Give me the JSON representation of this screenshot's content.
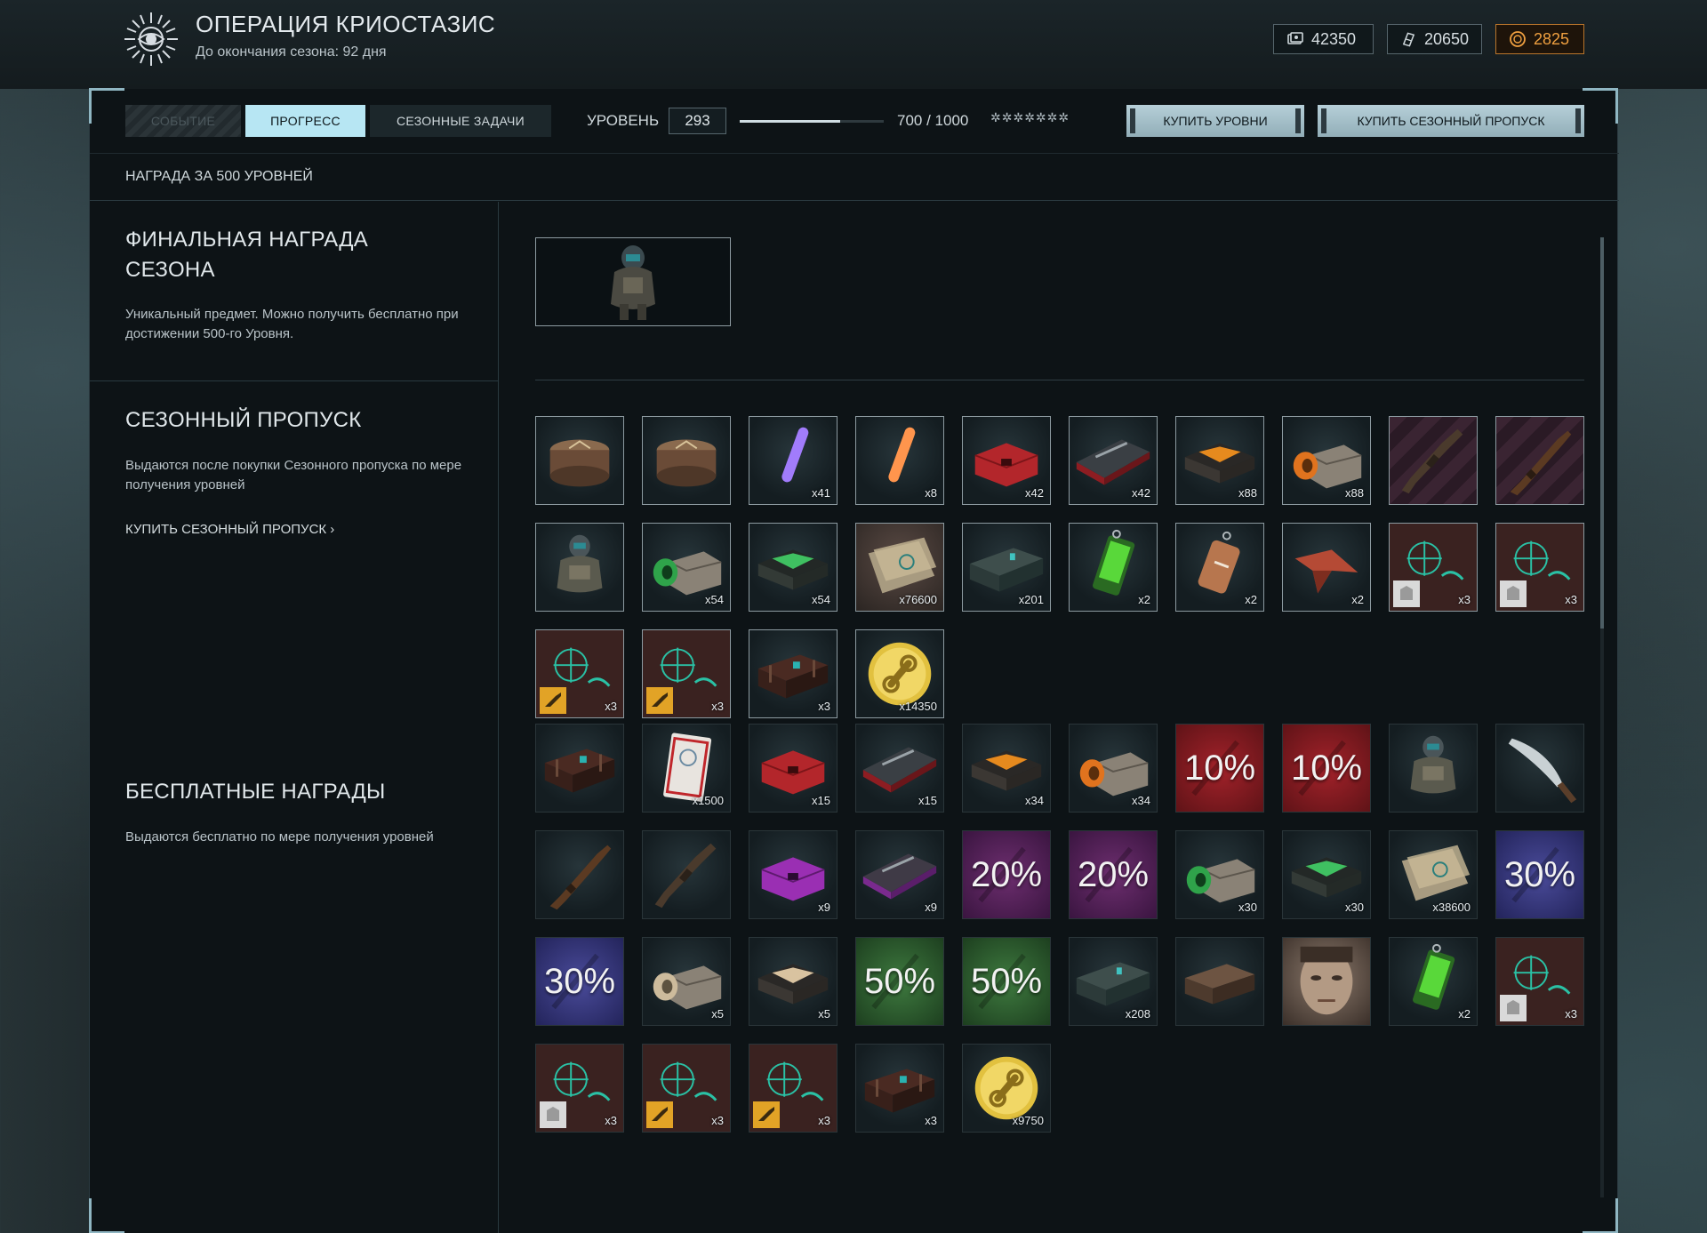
{
  "header": {
    "title": "ОПЕРАЦИЯ КРИОСТАЗИС",
    "subtitle": "До окончания сезона: 92 дня",
    "currencies": [
      {
        "icon": "crowns-icon",
        "value": "42350"
      },
      {
        "icon": "warbucks-icon",
        "value": "20650"
      },
      {
        "icon": "gold-coin-icon",
        "value": "2825",
        "color": "#f0a040"
      }
    ]
  },
  "controls": {
    "tabs": [
      "СОБЫТИЕ",
      "ПРОГРЕСС",
      "СЕЗОННЫЕ ЗАДАЧИ"
    ],
    "active_tab": "ПРОГРЕСС",
    "level_label": "УРОВЕНЬ",
    "level": "293",
    "xp_text": "700 / 1000",
    "xp_fraction": 0.7,
    "stars": "✲✲✲✲✲✲✲",
    "buy_levels": "КУПИТЬ УРОВНИ",
    "buy_pass": "КУПИТЬ СЕЗОННЫЙ ПРОПУСК"
  },
  "subheader": "НАГРАДА ЗА 500 УРОВНЕЙ",
  "sections": {
    "final": {
      "title_line1": "ФИНАЛЬНАЯ НАГРАДА",
      "title_line2": "СЕЗОНА",
      "desc": "Уникальный предмет. Можно получить бесплатно при достижении 500-го Уровня."
    },
    "pass": {
      "title": "СЕЗОННЫЙ ПРОПУСК",
      "desc": "Выдаются после покупки Сезонного пропуска по мере получения уровней",
      "link": "КУПИТЬ СЕЗОННЫЙ ПРОПУСК ›"
    },
    "free": {
      "title": "БЕСПЛАТНЫЕ НАГРАДЫ",
      "desc": "Выдаются бесплатно по мере получения уровней"
    }
  },
  "accent_color": "#b7e6f3",
  "premium_rewards": [
    {
      "icon": "crate-round-icon",
      "count": ""
    },
    {
      "icon": "crate-round-icon",
      "count": ""
    },
    {
      "icon": "purple-glowstick-icon",
      "count": "x41"
    },
    {
      "icon": "orange-glowstick-icon",
      "count": "x8"
    },
    {
      "icon": "red-case-icon",
      "count": "x42"
    },
    {
      "icon": "red-weapon-case-icon",
      "count": "x42"
    },
    {
      "icon": "orange-x-box-icon",
      "count": "x88"
    },
    {
      "icon": "orange-open-box-icon",
      "count": "x88"
    },
    {
      "icon": "rifle-icon",
      "count": ""
    },
    {
      "icon": "shotgun-icon",
      "count": ""
    },
    {
      "icon": "armor-suit-icon",
      "count": ""
    },
    {
      "icon": "green-open-box-icon",
      "count": "x54"
    },
    {
      "icon": "green-x-box-icon",
      "count": "x54"
    },
    {
      "icon": "map-sheets-icon",
      "count": "x76600"
    },
    {
      "icon": "ammo-crate-icon",
      "count": "x201"
    },
    {
      "icon": "green-tag-icon",
      "count": "x2"
    },
    {
      "icon": "dog-tag-icon",
      "count": "x2"
    },
    {
      "icon": "origami-bird-icon",
      "count": "x2"
    },
    {
      "icon": "camo-pattern-icon",
      "count": "x3",
      "tag": "armor"
    },
    {
      "icon": "camo-pattern-icon",
      "count": "x3",
      "tag": "armor"
    },
    {
      "icon": "camo-pattern-icon",
      "count": "x3",
      "tag": "weapon"
    },
    {
      "icon": "camo-pattern-icon",
      "count": "x3",
      "tag": "weapon"
    },
    {
      "icon": "dark-chest-icon",
      "count": "x3"
    },
    {
      "icon": "gold-link-coin-icon",
      "count": "x14350"
    }
  ],
  "free_rewards": [
    {
      "icon": "dark-chest-icon",
      "count": ""
    },
    {
      "icon": "ticket-card-icon",
      "count": "x1500"
    },
    {
      "icon": "red-case-icon",
      "count": "x15"
    },
    {
      "icon": "red-weapon-case-icon",
      "count": "x15"
    },
    {
      "icon": "orange-x-box-icon",
      "count": "x34"
    },
    {
      "icon": "orange-open-box-icon",
      "count": "x34"
    },
    {
      "icon": "discount-icon",
      "count": "",
      "percent": "10%",
      "bg": "red"
    },
    {
      "icon": "discount-icon",
      "count": "",
      "percent": "10%",
      "bg": "red"
    },
    {
      "icon": "armor-suit-icon",
      "count": ""
    },
    {
      "icon": "knife-icon",
      "count": ""
    },
    {
      "icon": "shotgun-icon",
      "count": ""
    },
    {
      "icon": "rifle-icon",
      "count": ""
    },
    {
      "icon": "purple-case-icon",
      "count": "x9"
    },
    {
      "icon": "purple-weapon-case-icon",
      "count": "x9"
    },
    {
      "icon": "discount-icon",
      "count": "",
      "percent": "20%",
      "bg": "purple"
    },
    {
      "icon": "discount-icon",
      "count": "",
      "percent": "20%",
      "bg": "purple"
    },
    {
      "icon": "green-open-box-icon",
      "count": "x30"
    },
    {
      "icon": "green-x-box-icon",
      "count": "x30"
    },
    {
      "icon": "map-sheets-icon",
      "count": "x38600"
    },
    {
      "icon": "discount-icon",
      "count": "",
      "percent": "30%",
      "bg": "blue"
    },
    {
      "icon": "discount-icon",
      "count": "",
      "percent": "30%",
      "bg": "blue"
    },
    {
      "icon": "tan-open-box-icon",
      "count": "x5"
    },
    {
      "icon": "tan-x-box-icon",
      "count": "x5"
    },
    {
      "icon": "discount-icon",
      "count": "",
      "percent": "50%",
      "bg": "green"
    },
    {
      "icon": "discount-icon",
      "count": "",
      "percent": "50%",
      "bg": "green"
    },
    {
      "icon": "ammo-crate-icon",
      "count": "x208"
    },
    {
      "icon": "wood-crate-icon",
      "count": ""
    },
    {
      "icon": "face-portrait-icon",
      "count": ""
    },
    {
      "icon": "green-tag-icon",
      "count": "x2"
    },
    {
      "icon": "camo-pattern-icon",
      "count": "x3",
      "tag": "armor"
    },
    {
      "icon": "camo-pattern-icon",
      "count": "x3",
      "tag": "armor"
    },
    {
      "icon": "camo-pattern-icon",
      "count": "x3",
      "tag": "weapon"
    },
    {
      "icon": "camo-pattern-icon",
      "count": "x3",
      "tag": "weapon"
    },
    {
      "icon": "dark-chest-icon",
      "count": "x3"
    },
    {
      "icon": "gold-link-coin-icon",
      "count": "x9750"
    }
  ]
}
